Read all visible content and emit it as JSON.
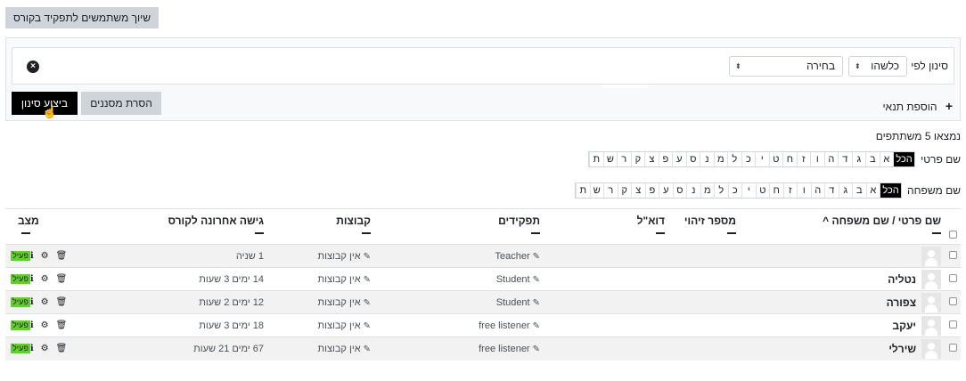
{
  "enrol_button": "שיוך משתמשים לתפקיד בקורס",
  "filter": {
    "label": "סינון לפי",
    "match_value": "כלשהו",
    "type_value": "בחירה",
    "add_condition": "הוספת תנאי",
    "apply_label": "ביצוע סינון",
    "clear_label": "הסרת מסננים"
  },
  "found_text": "נמצאו 5 משתתפים",
  "firstname_label": "שם פרטי",
  "lastname_label": "שם משפחה",
  "all_label": "הכל",
  "letters": [
    "א",
    "ב",
    "ג",
    "ד",
    "ה",
    "ו",
    "ז",
    "ח",
    "ט",
    "י",
    "כ",
    "ל",
    "מ",
    "נ",
    "ס",
    "ע",
    "פ",
    "צ",
    "ק",
    "ר",
    "ש",
    "ת"
  ],
  "columns": {
    "name": "שם פרטי / שם משפחה",
    "sort_indicator": "^",
    "idnumber": "מספר זיהוי",
    "email": "דוא\"ל",
    "roles": "תפקידים",
    "groups": "קבוצות",
    "lastaccess": "גישה אחרונה לקורס",
    "status": "מצב"
  },
  "rows": [
    {
      "name": "",
      "role": "Teacher",
      "groups": "אין קבוצות",
      "lastaccess": "1 שניה",
      "status": "פעיל"
    },
    {
      "name": "נטליה",
      "role": "Student",
      "groups": "אין קבוצות",
      "lastaccess": "14 ימים 3 שעות",
      "status": "פעיל"
    },
    {
      "name": "צפורה",
      "role": "Student",
      "groups": "אין קבוצות",
      "lastaccess": "12 ימים 2 שעות",
      "status": "פעיל"
    },
    {
      "name": "יעקב",
      "role": "free listener",
      "groups": "אין קבוצות",
      "lastaccess": "18 ימים 3 שעות",
      "status": "פעיל"
    },
    {
      "name": "שירלי",
      "role": "free listener",
      "groups": "אין קבוצות",
      "lastaccess": "67 ימים 21 שעות",
      "status": "פעיל"
    }
  ],
  "icons": {
    "clear": "×",
    "plus": "+",
    "pencil": "✎",
    "info": "ℹ",
    "gear": "⚙",
    "trash": "🗑",
    "select_arrow": "⬍",
    "cursor": "☝"
  },
  "colors": {
    "active_badge": "#66cc33",
    "apply_button": "#000000",
    "row_alt": "#f2f2f2"
  }
}
